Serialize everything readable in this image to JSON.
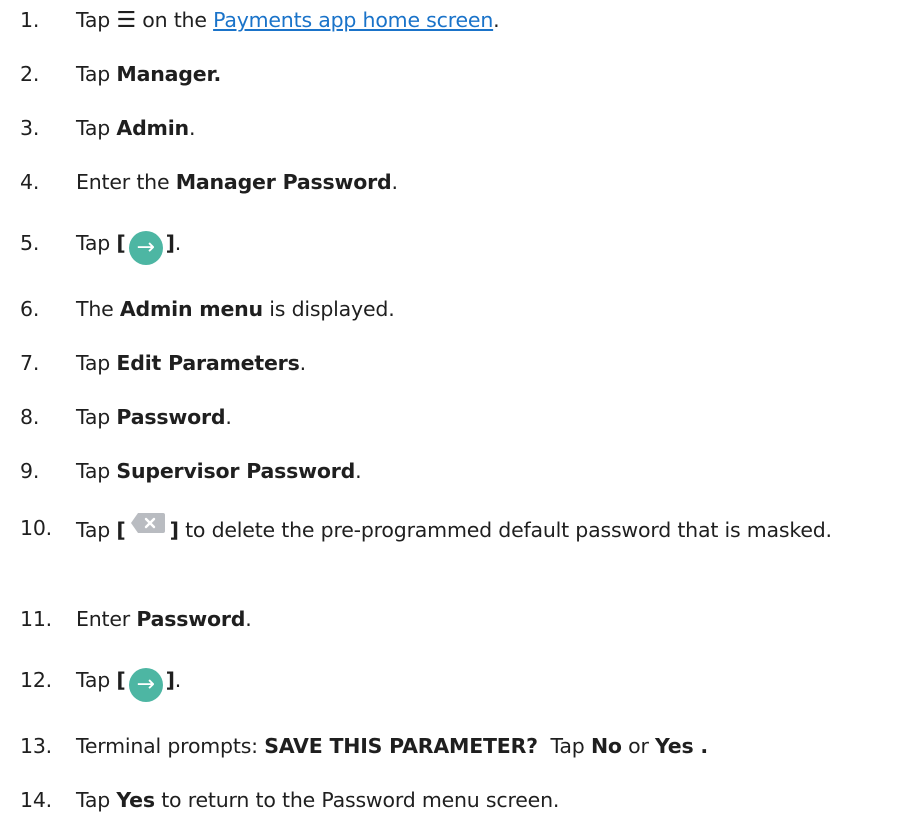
{
  "steps": [
    {
      "num": "1.",
      "pre": "Tap ",
      "glyph": "☰",
      "mid": " on the ",
      "link": "Payments app home screen",
      "post": "."
    },
    {
      "num": "2.",
      "pre": "Tap ",
      "bold": "Manager.",
      "post": ""
    },
    {
      "num": "3.",
      "pre": "Tap ",
      "bold": "Admin",
      "post": "."
    },
    {
      "num": "4.",
      "pre": "Enter the ",
      "bold": "Manager Password",
      "post": "."
    },
    {
      "num": "5.",
      "pre": "Tap ",
      "bracket_open": "[",
      "bracket_close": "]",
      "post": "."
    },
    {
      "num": "6.",
      "pre": "The ",
      "bold": "Admin menu",
      "post": " is displayed."
    },
    {
      "num": "7.",
      "pre": "Tap ",
      "bold": "Edit Parameters",
      "post": "."
    },
    {
      "num": "8.",
      "pre": "Tap ",
      "bold": "Password",
      "post": "."
    },
    {
      "num": "9.",
      "pre": "Tap ",
      "bold": "Supervisor Password",
      "post": "."
    },
    {
      "num": "10.",
      "pre": "Tap ",
      "bracket_open": "[",
      "bracket_close": "]",
      "post": " to delete the pre-programmed default password that is masked."
    },
    {
      "num": "11.",
      "pre": "Enter ",
      "bold": "Password",
      "post": "."
    },
    {
      "num": "12.",
      "pre": "Tap ",
      "bracket_open": "[",
      "bracket_close": "]",
      "post": "."
    },
    {
      "num": "13.",
      "pre": "Terminal prompts: ",
      "bold": "SAVE THIS PARAMETER?",
      "mid": "  Tap ",
      "bold2": "No",
      "mid2": " or ",
      "bold3": "Yes .",
      "post": ""
    },
    {
      "num": "14.",
      "pre": "Tap ",
      "bold": "Yes",
      "post": " to return to the Password menu screen."
    }
  ],
  "colors": {
    "text": "#1f1f1f",
    "link": "#1a73c9",
    "arrow_button": "#4db6a3",
    "backspace_button": "#b9bcc1"
  },
  "icons": {
    "arrow_button": "arrow-right-circle-icon",
    "backspace_button": "backspace-x-icon",
    "menu": "hamburger-menu-icon"
  }
}
